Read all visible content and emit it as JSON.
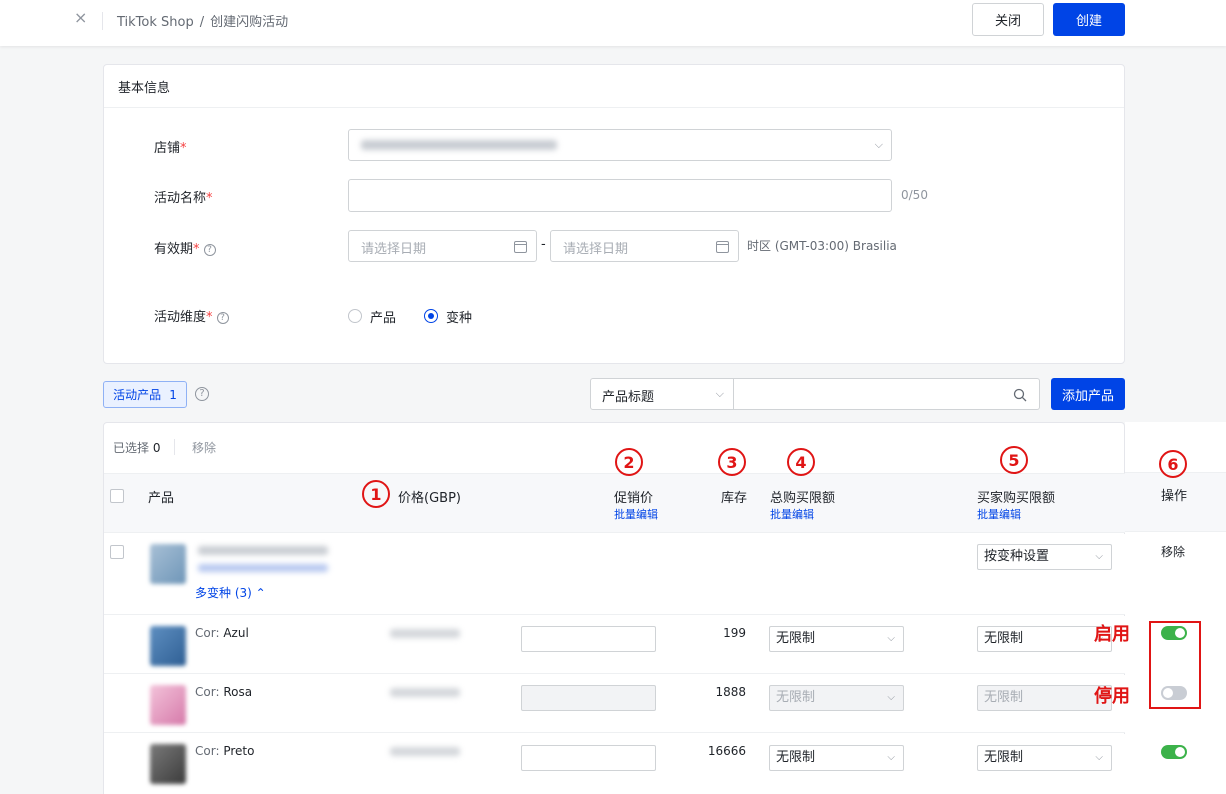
{
  "header": {
    "breadcrumb_root": "TikTok Shop",
    "breadcrumb_sep": "/",
    "breadcrumb_current": "创建闪购活动",
    "close_label": "关闭",
    "create_label": "创建",
    "close_icon": "×"
  },
  "basic_info": {
    "title": "基本信息",
    "store_label": "店铺",
    "name_label": "活动名称",
    "name_counter": "0/50",
    "period_label": "有效期",
    "date_placeholder_start": "请选择日期",
    "date_placeholder_end": "请选择日期",
    "date_dash": "-",
    "timezone": "时区 (GMT-03:00) Brasilia",
    "dimension_label": "活动维度",
    "dimension_options": [
      "产品",
      "变种"
    ],
    "dimension_selected": "变种",
    "required_mark": "*",
    "help_mark": "?"
  },
  "toolbar": {
    "active_tab_label": "活动产品",
    "active_tab_count": "1",
    "search_field_select": "产品标题",
    "add_product_label": "添加产品"
  },
  "table": {
    "selected_label": "已选择",
    "selected_count": "0",
    "remove_label": "移除",
    "headers": {
      "product": "产品",
      "price": "价格(GBP)",
      "promo_price": "促销价",
      "stock": "库存",
      "total_limit": "总购买限额",
      "buyer_limit": "买家购买限额",
      "action": "操作"
    },
    "batch_edit_label": "批量编辑",
    "product_row": {
      "variants_label": "多变种 (3)",
      "buyer_limit_value": "按变种设置",
      "action_label": "移除"
    },
    "variants": [
      {
        "attr_key": "Cor:",
        "attr_value": "Azul",
        "stock": "199",
        "total_limit": "无限制",
        "buyer_limit": "无限制",
        "enabled": true,
        "disabled_inputs": false
      },
      {
        "attr_key": "Cor:",
        "attr_value": "Rosa",
        "stock": "1888",
        "total_limit": "无限制",
        "buyer_limit": "无限制",
        "enabled": false,
        "disabled_inputs": true
      },
      {
        "attr_key": "Cor:",
        "attr_value": "Preto",
        "stock": "16666",
        "total_limit": "无限制",
        "buyer_limit": "无限制",
        "enabled": true,
        "disabled_inputs": false
      }
    ]
  },
  "annotations": {
    "markers": [
      "1",
      "2",
      "3",
      "4",
      "5",
      "6"
    ],
    "enabled_text": "启用",
    "disabled_text": "停用"
  },
  "colors": {
    "primary": "#0044e6",
    "annotation_red": "#e01515",
    "toggle_on": "#3cb24a",
    "toggle_off": "#c9cdd4"
  }
}
